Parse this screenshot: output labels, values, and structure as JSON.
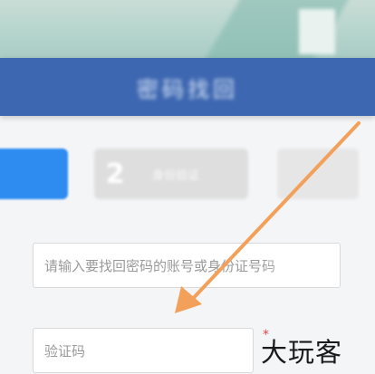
{
  "header": {
    "title": "密码找回"
  },
  "steps": [
    {
      "number": "",
      "label": ""
    },
    {
      "number": "2",
      "label": "身份验证"
    },
    {
      "number": "",
      "label": ""
    }
  ],
  "form": {
    "account_placeholder": "请输入要找回密码的账号或身份证号码",
    "code_placeholder": "验证码",
    "required_mark": "*"
  },
  "watermark": {
    "text": "大玩客"
  },
  "colors": {
    "header_blue": "#3d67b1",
    "step_active": "#2e8cf0",
    "arrow_orange": "#f2a05a"
  },
  "icons": {
    "annotation": "arrow-annotation-icon"
  }
}
